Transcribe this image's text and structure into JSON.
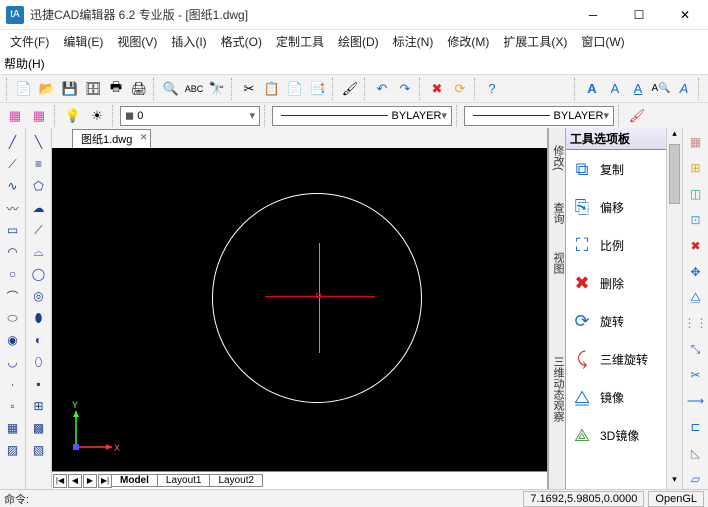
{
  "title": "迅捷CAD编辑器 6.2 专业版  - [图纸1.dwg]",
  "menus": [
    "文件(F)",
    "编辑(E)",
    "视图(V)",
    "插入(I)",
    "格式(O)",
    "定制工具",
    "绘图(D)",
    "标注(N)",
    "修改(M)",
    "扩展工具(X)",
    "窗口(W)"
  ],
  "help_menu": "帮助(H)",
  "layer_current": "0",
  "linetype": "BYLAYER",
  "linetype2": "BYLAYER",
  "doc_tab": "图纸1.dwg",
  "layout_tabs": [
    "Model",
    "Layout1",
    "Layout2"
  ],
  "palette_title": "工具选项板",
  "palette_side1": "修改(",
  "palette_side2": "查询",
  "palette_side3": "视图",
  "palette_side4": "三维动态观察",
  "palette_items": [
    {
      "label": "复制",
      "icon": "copy",
      "color": "#1a6dd6"
    },
    {
      "label": "偏移",
      "icon": "offset",
      "color": "#1a6dd6"
    },
    {
      "label": "比例",
      "icon": "scale",
      "color": "#1a6dd6"
    },
    {
      "label": "删除",
      "icon": "delete",
      "color": "#e02020"
    },
    {
      "label": "旋转",
      "icon": "rotate",
      "color": "#1a6dd6"
    },
    {
      "label": "三维旋转",
      "icon": "rotate3d",
      "color": "#e02020"
    },
    {
      "label": "镜像",
      "icon": "mirror",
      "color": "#1a6dd6"
    },
    {
      "label": "3D镜像",
      "icon": "mirror3d",
      "color": "#4a9d4a"
    }
  ],
  "status_cmd": "命令:",
  "status_coords": "7.1692,5.9805,0.0000",
  "status_render": "OpenGL",
  "ucs": {
    "x": "X",
    "y": "Y"
  },
  "nav_btns": [
    "|◀",
    "◀",
    "▶",
    "▶|"
  ]
}
